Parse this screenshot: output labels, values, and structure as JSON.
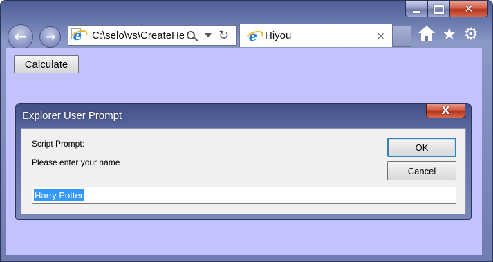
{
  "window": {
    "caption_buttons": {
      "minimize_icon": "minimize-icon",
      "maximize_icon": "maximize-icon",
      "close_icon": "close-icon"
    }
  },
  "navigation": {
    "address": "C:\\selo\\vs\\CreateHe",
    "tab_title": "Hiyou",
    "tab_close": "×"
  },
  "page": {
    "background": "#c2c2ff",
    "calculate_label": "Calculate"
  },
  "dialog": {
    "title": "Explorer User Prompt",
    "close_glyph": "X",
    "label": "Script Prompt:",
    "message": "Please enter your name",
    "ok_label": "OK",
    "cancel_label": "Cancel",
    "input_value": "Harry Potter"
  }
}
